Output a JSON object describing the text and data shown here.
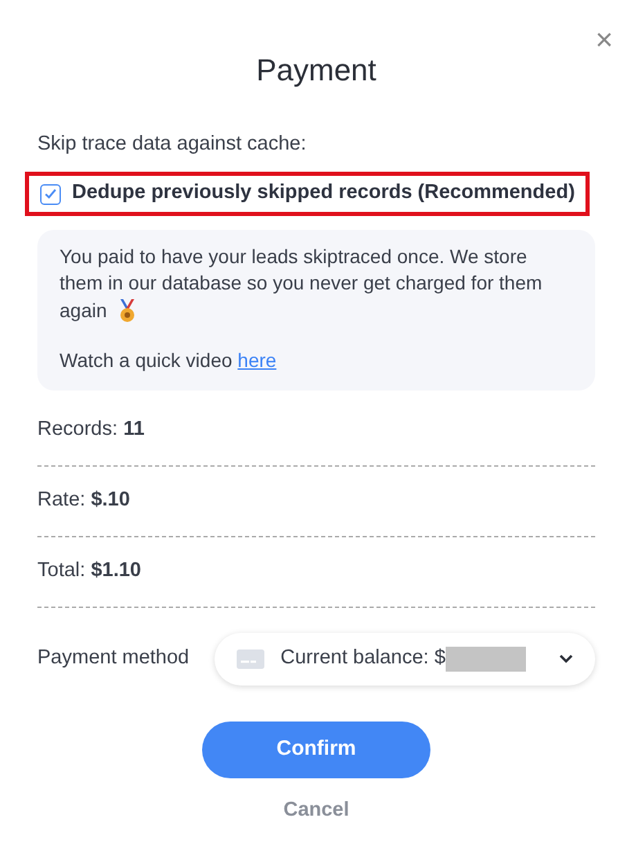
{
  "dialog": {
    "title": "Payment",
    "close": "×"
  },
  "cache": {
    "label": "Skip trace data against cache:",
    "option": {
      "label": "Dedupe previously skipped records (Recommended)",
      "checked": true,
      "highlighted": true
    }
  },
  "info": {
    "text": "You paid to have your leads skiptraced once. We store them in our database so you never get charged for them",
    "text_end": "again",
    "video_text": "Watch a quick video ",
    "video_link": "here"
  },
  "summary": [
    {
      "text": "Records: **11**"
    },
    {
      "text": "Rate: **$.10**"
    },
    {
      "text": "Total: **$1.10**"
    }
  ],
  "payment": {
    "label": "Payment method",
    "value": "Current balance: $",
    "redacted": true
  },
  "buttons": {
    "confirm": "Confirm",
    "cancel": "Cancel"
  }
}
